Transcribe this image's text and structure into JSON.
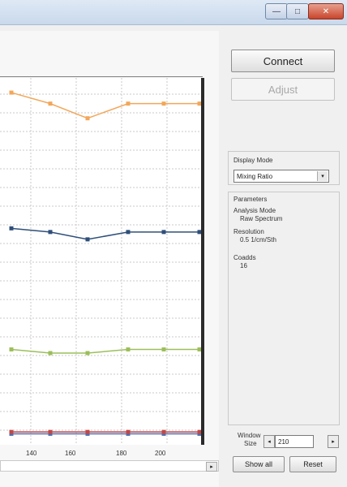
{
  "window": {
    "minimize_icon": "minimize-icon",
    "maximize_icon": "maximize-icon",
    "close_icon": "close-icon"
  },
  "plot": {
    "x_tick_labels": [
      "140",
      "160",
      "180",
      "200"
    ],
    "series": [
      {
        "name": "",
        "color": "#f2a75a",
        "values": [
          0.96,
          0.93,
          0.89,
          0.93,
          0.93,
          0.93
        ]
      },
      {
        "name": "",
        "color": "#2f4f7a",
        "values": [
          0.59,
          0.58,
          0.56,
          0.58,
          0.58,
          0.58
        ]
      },
      {
        "name": "",
        "color": "#9cbf5a",
        "values": [
          0.26,
          0.25,
          0.25,
          0.26,
          0.26,
          0.26
        ]
      },
      {
        "name": "",
        "color": "#4f6fb0",
        "values": [
          0.03,
          0.03,
          0.03,
          0.03,
          0.03,
          0.03
        ]
      },
      {
        "name": "",
        "color": "#c04848",
        "values": [
          0.035,
          0.035,
          0.035,
          0.035,
          0.035,
          0.035
        ]
      }
    ]
  },
  "panel": {
    "connect_label": "Connect",
    "adjust_label": "Adjust",
    "display_mode_label": "Display Mode",
    "display_mode_value": "Mixing Ratio",
    "parameters_label": "Parameters",
    "analysis_mode_label": "Analysis Mode",
    "analysis_mode_value": "Raw Spectrum",
    "resolution_label": "Resolution",
    "resolution_value": "0.5 1/cm/Sth",
    "coadds_label": "Coadds",
    "coadds_value": "16",
    "window_size_label_1": "Window",
    "window_size_label_2": "Size",
    "window_size_value": "210",
    "show_all_label": "Show all",
    "reset_label": "Reset"
  }
}
